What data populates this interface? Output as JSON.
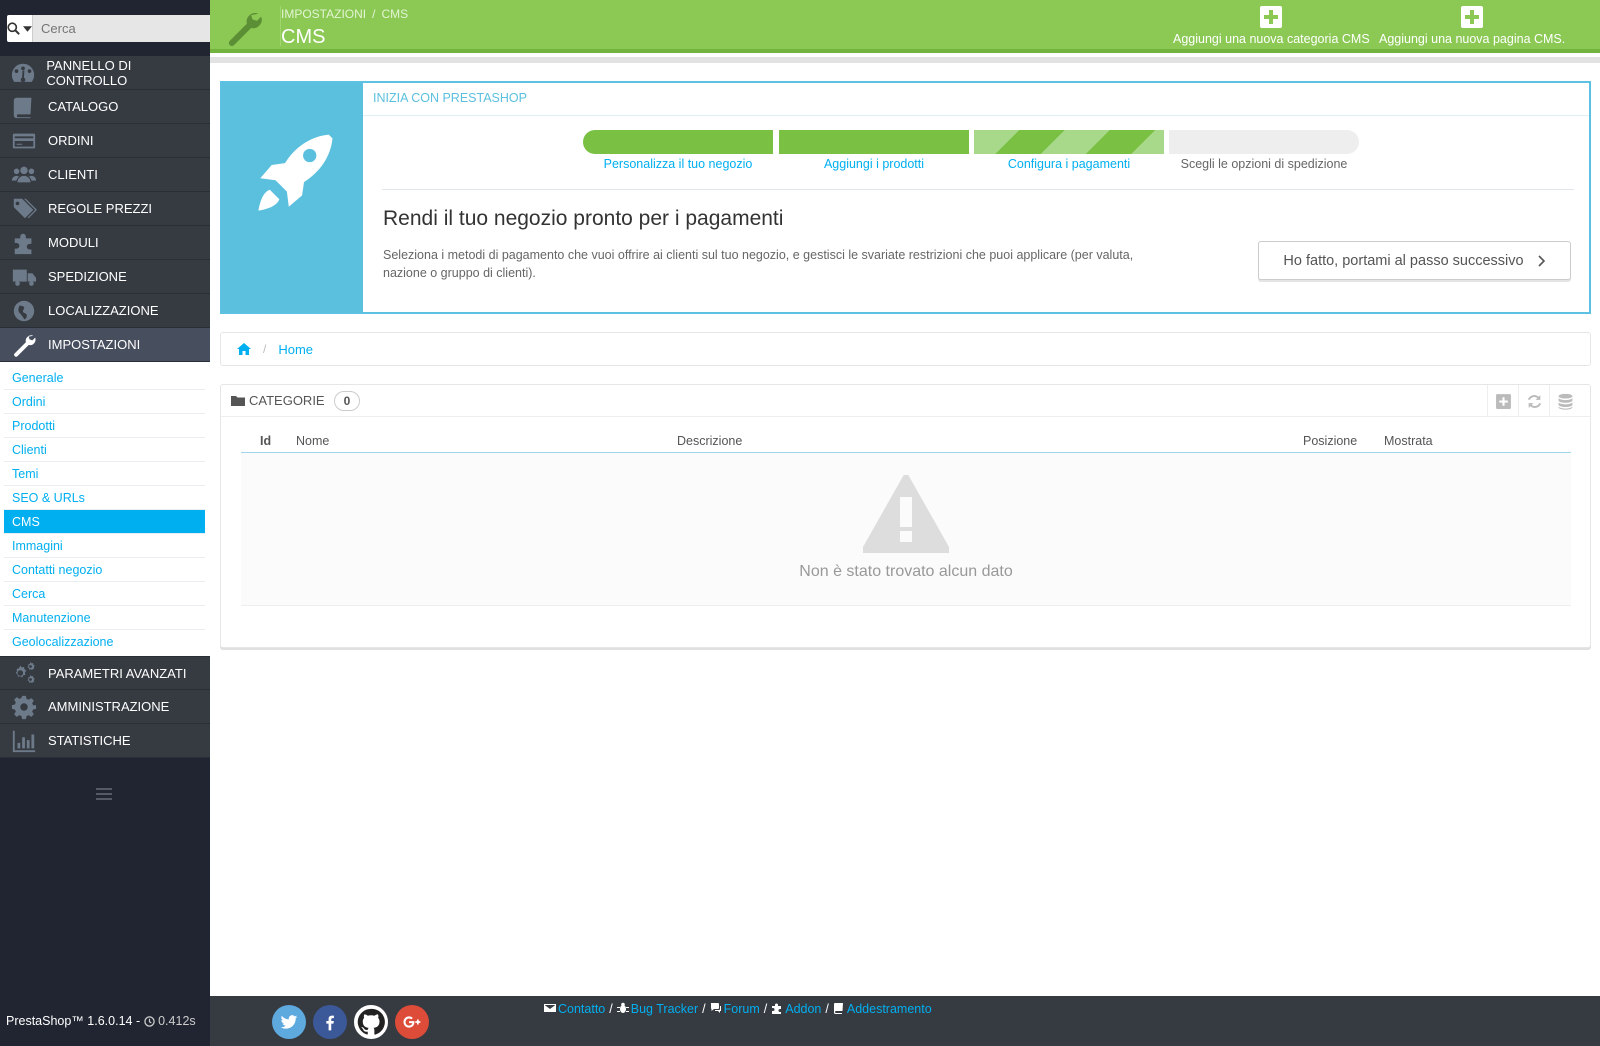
{
  "sidebar": {
    "search_placeholder": "Cerca",
    "menu": [
      {
        "label": "PANNELLO DI CONTROLLO",
        "icon": "dashboard-icon"
      },
      {
        "label": "CATALOGO",
        "icon": "book-icon"
      },
      {
        "label": "ORDINI",
        "icon": "credit-card-icon"
      },
      {
        "label": "CLIENTI",
        "icon": "users-icon"
      },
      {
        "label": "REGOLE PREZZI",
        "icon": "tags-icon"
      },
      {
        "label": "MODULI",
        "icon": "puzzle-icon"
      },
      {
        "label": "SPEDIZIONE",
        "icon": "truck-icon"
      },
      {
        "label": "LOCALIZZAZIONE",
        "icon": "globe-icon"
      },
      {
        "label": "IMPOSTAZIONI",
        "icon": "wrench-icon"
      }
    ],
    "submenu": [
      "Generale",
      "Ordini",
      "Prodotti",
      "Clienti",
      "Temi",
      "SEO & URLs",
      "CMS",
      "Immagini",
      "Contatti negozio",
      "Cerca",
      "Manutenzione",
      "Geolocalizzazione"
    ],
    "submenu_active": "CMS",
    "menu_after": [
      {
        "label": "PARAMETRI AVANZATI",
        "icon": "cogs-icon"
      },
      {
        "label": "AMMINISTRAZIONE",
        "icon": "gear-icon"
      },
      {
        "label": "STATISTICHE",
        "icon": "bar-chart-icon"
      }
    ]
  },
  "header": {
    "breadcrumb": [
      "IMPOSTAZIONI",
      "CMS"
    ],
    "title": "CMS",
    "add_category": "Aggiungi una nuova categoria CMS",
    "add_page": "Aggiungi una nuova pagina CMS."
  },
  "onboarding": {
    "title": "INIZIA CON PRESTASHOP",
    "steps": [
      "Personalizza il tuo negozio",
      "Aggiungi i prodotti",
      "Configura i pagamenti",
      "Scegli le opzioni di spedizione"
    ],
    "heading": "Rendi il tuo negozio pronto per i pagamenti",
    "description": "Seleziona i metodi di pagamento che vuoi offrire ai clienti sul tuo negozio, e gestisci le svariate restrizioni che puoi applicare (per valuta, nazione o gruppo di clienti).",
    "next_button": "Ho fatto, portami al passo successivo",
    "accent_color": "#5bc0de"
  },
  "breadcrumb": {
    "home": "Home"
  },
  "categories": {
    "title": "CATEGORIE",
    "count": "0",
    "columns": [
      "Id",
      "Nome",
      "Descrizione",
      "Posizione",
      "Mostrata"
    ],
    "empty_text": "Non è stato trovato alcun dato"
  },
  "footer": {
    "version": "PrestaShop™ 1.6.0.14 -",
    "time": "0.412s",
    "links": [
      "Contatto",
      "Bug Tracker",
      "Forum",
      "Addon",
      "Addestramento"
    ],
    "separator": "/"
  },
  "colors": {
    "header_green": "#8bc954",
    "link_blue": "#00aff0",
    "sidebar_dark": "#363a41"
  }
}
